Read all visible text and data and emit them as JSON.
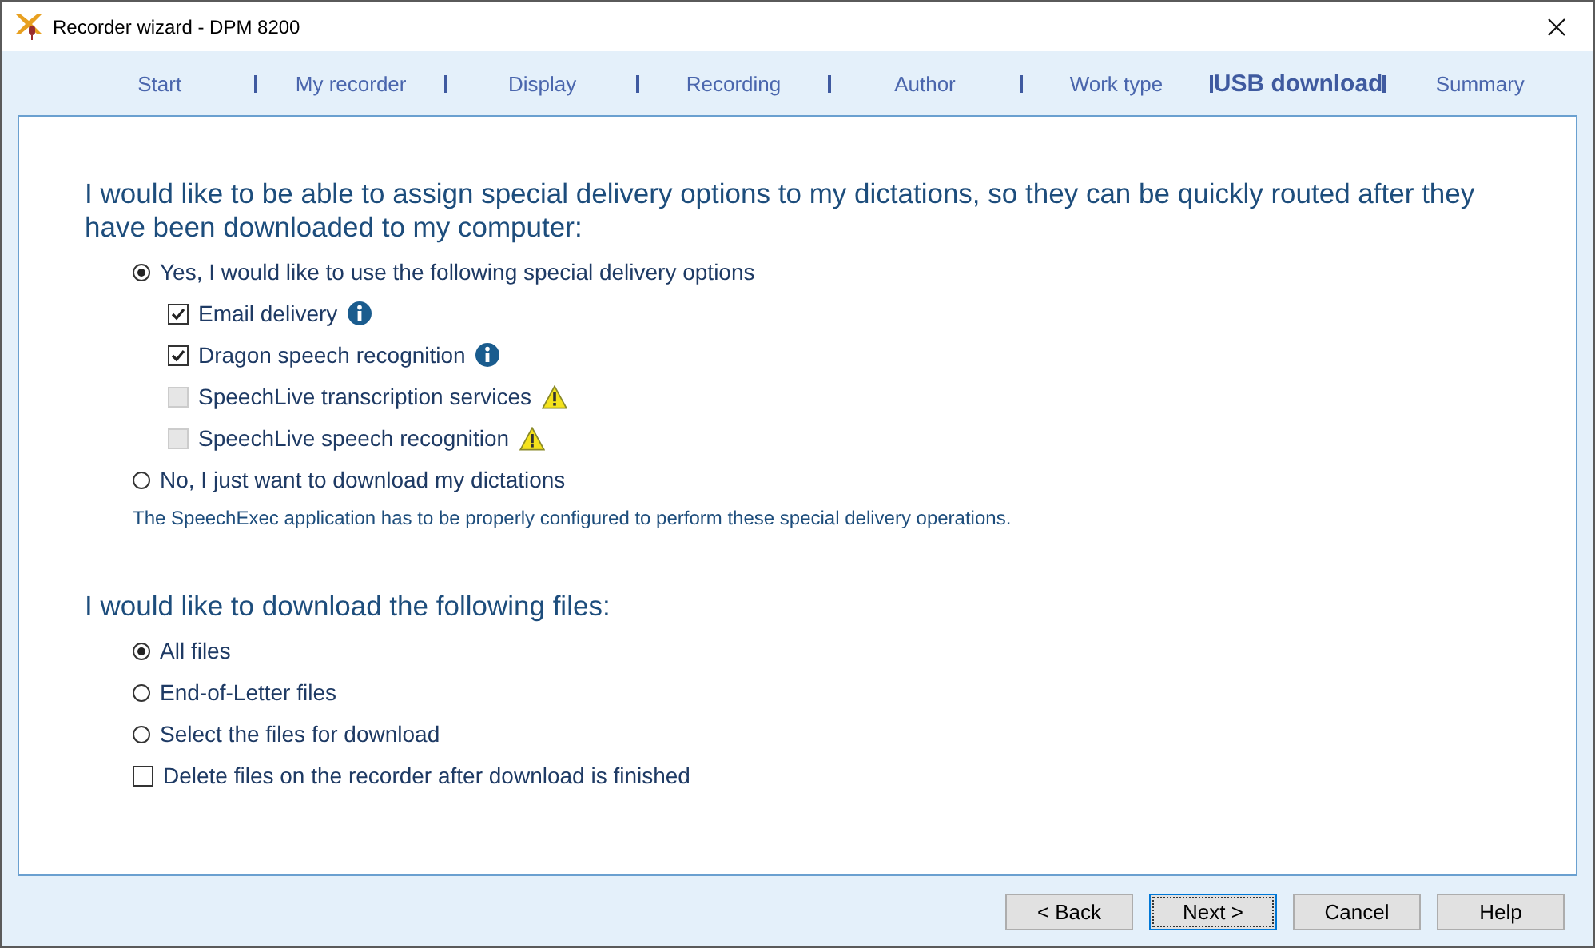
{
  "window": {
    "title": "Recorder wizard - DPM 8200"
  },
  "steps": [
    {
      "label": "Start",
      "selected": false
    },
    {
      "label": "My recorder",
      "selected": false
    },
    {
      "label": "Display",
      "selected": false
    },
    {
      "label": "Recording",
      "selected": false
    },
    {
      "label": "Author",
      "selected": false
    },
    {
      "label": "Work type",
      "selected": false
    },
    {
      "label": "USB download",
      "selected": true
    },
    {
      "label": "Summary",
      "selected": false
    }
  ],
  "sections": [
    {
      "heading": "I would like to be able to assign special delivery options to my dictations, so they can be quickly routed after they have been downloaded to my computer:",
      "options": [
        {
          "kind": "radio",
          "label": "Yes, I would like to use the following special delivery options",
          "selected": true,
          "children": [
            {
              "label": "Email delivery",
              "checked": true,
              "disabled": false
            },
            {
              "label": "Dragon speech recognition",
              "checked": true,
              "disabled": false
            },
            {
              "label": "SpeechLive transcription services",
              "checked": false,
              "disabled": true
            },
            {
              "label": "SpeechLive speech recognition",
              "checked": false,
              "disabled": true
            }
          ]
        },
        {
          "kind": "radio",
          "label": "No, I just want to download my dictations",
          "selected": false
        }
      ],
      "note": "The SpeechExec application has to be properly configured to perform these special delivery operations."
    },
    {
      "heading": "I would like to download the following files:",
      "options": [
        {
          "kind": "radio",
          "label": "All files",
          "selected": true
        },
        {
          "kind": "radio",
          "label": "End-of-Letter files",
          "selected": false
        },
        {
          "kind": "radio",
          "label": "Select the files for download",
          "selected": false
        },
        {
          "kind": "checkbox",
          "label": "Delete files on the recorder after download is finished",
          "checked": false
        }
      ]
    }
  ],
  "buttons": [
    {
      "label": "< Back",
      "focused": false
    },
    {
      "label": "Next >",
      "focused": true
    },
    {
      "label": "Cancel",
      "focused": false
    },
    {
      "label": "Help",
      "focused": false
    }
  ]
}
